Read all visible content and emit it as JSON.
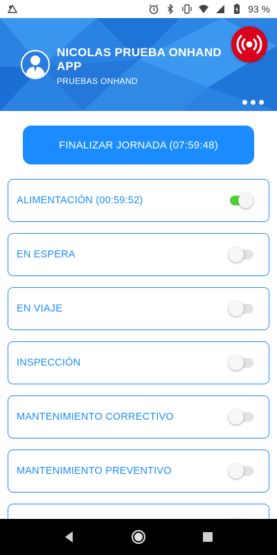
{
  "status_bar": {
    "battery_percent": "93 %",
    "icons": [
      "notification-icon",
      "alarm-clock-icon",
      "bluetooth-icon",
      "vibrate-icon",
      "wifi-icon",
      "signal-icon",
      "battery-icon"
    ]
  },
  "header": {
    "user_name": "NICOLAS PRUEBA ONHAND APP",
    "company": "PRUEBAS ONHAND",
    "colors": {
      "background": "#2a7fe0",
      "alarm": "#d9001b"
    }
  },
  "main": {
    "finish_button_label": "FINALIZAR JORNADA (07:59:48)",
    "activities": [
      {
        "label": "ALIMENTACIÓN (00:59:52)",
        "active": true
      },
      {
        "label": "EN ESPERA",
        "active": false
      },
      {
        "label": "EN VIAJE",
        "active": false
      },
      {
        "label": "INSPECCIÓN",
        "active": false
      },
      {
        "label": "MANTENIMIENTO CORRECTIVO",
        "active": false
      },
      {
        "label": "MANTENIMIENTO PREVENTIVO",
        "active": false
      },
      {
        "label": "",
        "active": false
      }
    ],
    "colors": {
      "accent": "#1a8cff",
      "toggle_on": "#4cd137"
    }
  },
  "nav_bar": {
    "buttons": [
      "back-icon",
      "home-icon",
      "recents-icon"
    ]
  }
}
